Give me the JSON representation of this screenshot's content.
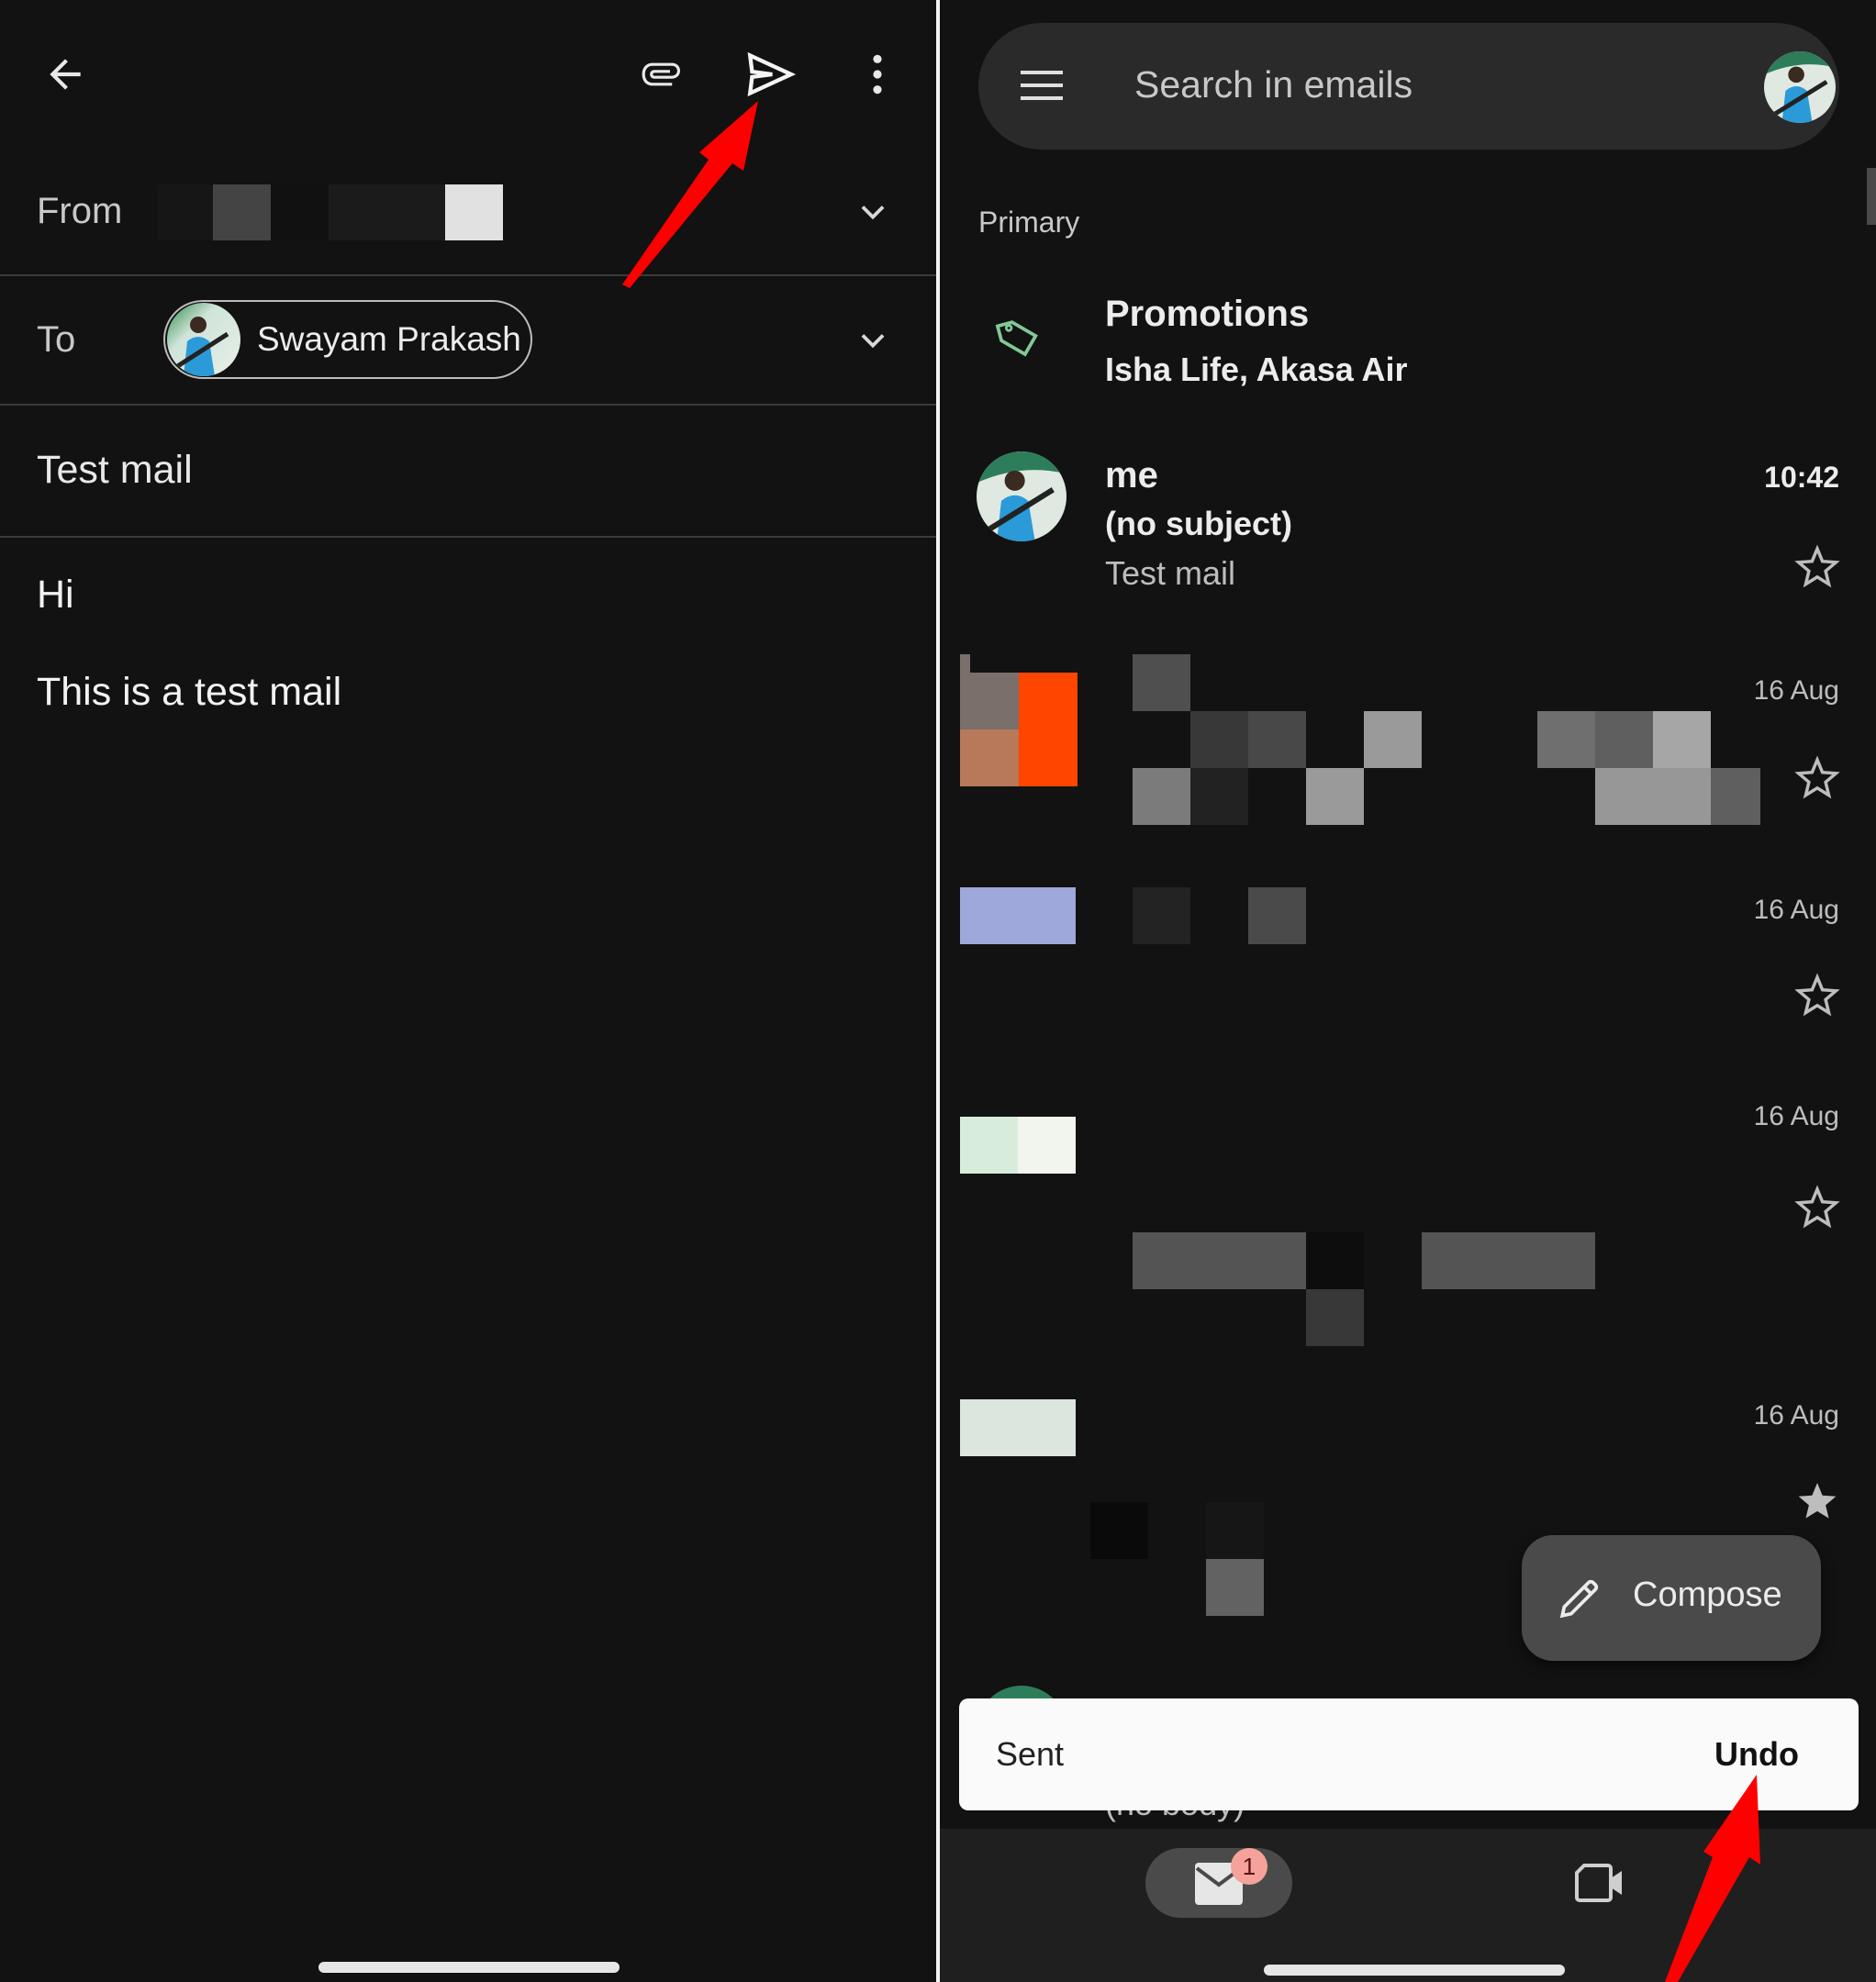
{
  "compose": {
    "toolbar": {
      "back_icon": "arrow-left",
      "attach_icon": "paperclip",
      "send_icon": "send-paper-plane",
      "more_icon": "more-vertical"
    },
    "from_label": "From",
    "to_label": "To",
    "recipient": {
      "name": "Swayam Prakash",
      "avatar": "profile-photo"
    },
    "subject": "Test mail",
    "body_lines": [
      "Hi",
      "This is a test mail"
    ]
  },
  "inbox": {
    "search_placeholder": "Search in emails",
    "section_label": "Primary",
    "promotions": {
      "title": "Promotions",
      "senders": "Isha Life, Akasa Air",
      "icon": "tag",
      "icon_color": "#81c995"
    },
    "emails": [
      {
        "sender": "me",
        "subject": "(no subject)",
        "snippet": "Test mail",
        "time": "10:42",
        "starred": false
      },
      {
        "sender": "",
        "subject": "",
        "snippet": "",
        "time": "16 Aug",
        "starred": false,
        "redacted": true
      },
      {
        "sender": "",
        "subject": "",
        "snippet": "",
        "time": "16 Aug",
        "starred": false,
        "redacted": true
      },
      {
        "sender": "",
        "subject": "",
        "snippet": "",
        "time": "16 Aug",
        "starred": false,
        "redacted": true
      },
      {
        "sender": "",
        "subject": "",
        "snippet": "",
        "time": "16 Aug",
        "starred": true,
        "redacted": true
      },
      {
        "sender": "",
        "subject": "",
        "snippet": "(no body)",
        "time": "",
        "starred": false,
        "partially_hidden": true
      }
    ],
    "compose_button": "Compose",
    "snackbar": {
      "message": "Sent",
      "action": "Undo"
    },
    "bottom_nav": {
      "mail_badge": "1",
      "mail_icon": "mail",
      "meet_icon": "video-camera"
    }
  },
  "annotations": {
    "arrow_color": "#ff0000",
    "arrows": [
      "points-to-send-button",
      "points-to-undo-action"
    ]
  }
}
